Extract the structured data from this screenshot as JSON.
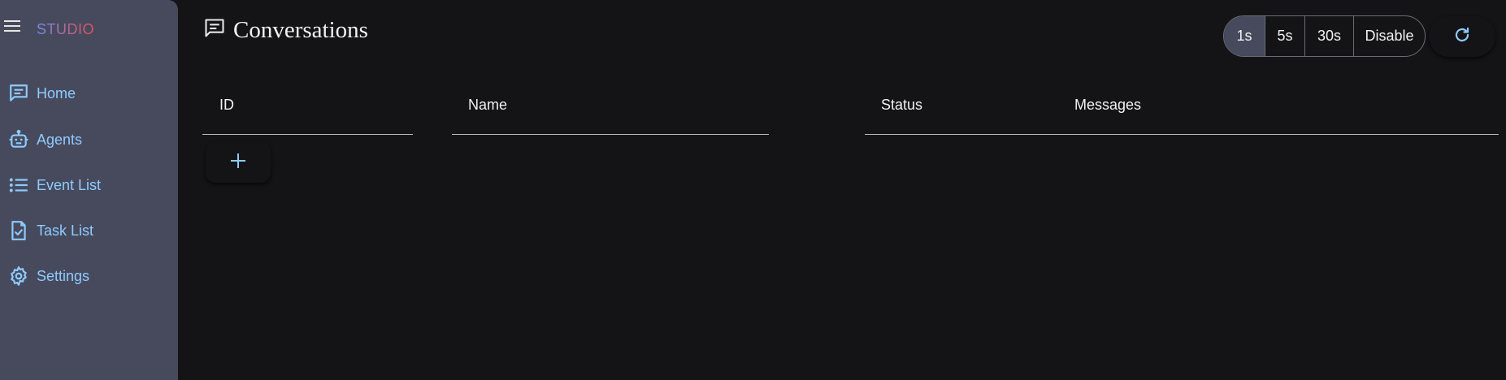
{
  "app": {
    "brand": "STUDIO"
  },
  "sidebar": {
    "items": [
      {
        "label": "Home",
        "icon": "chat-icon"
      },
      {
        "label": "Agents",
        "icon": "robot-icon"
      },
      {
        "label": "Event List",
        "icon": "list-icon"
      },
      {
        "label": "Task List",
        "icon": "task-icon"
      },
      {
        "label": "Settings",
        "icon": "gear-icon"
      }
    ]
  },
  "header": {
    "title": "Conversations",
    "title_icon": "chat-icon",
    "refresh_options": [
      "1s",
      "5s",
      "30s",
      "Disable"
    ],
    "selected_refresh": "1s",
    "reload_icon": "refresh-icon"
  },
  "table": {
    "columns": [
      "ID",
      "Name",
      "Status",
      "Messages"
    ],
    "add_icon": "plus-icon"
  },
  "colors": {
    "background": "#141416",
    "sidebar": "#474a5d",
    "accent": "#8ecbff",
    "text": "#f2f2f2"
  }
}
